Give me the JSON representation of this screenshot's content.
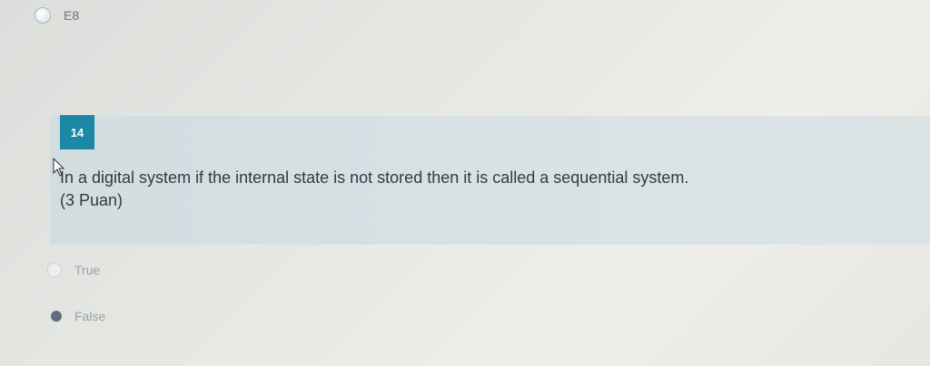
{
  "previous_option": {
    "label": "E8"
  },
  "question": {
    "number": "14",
    "text": "In a digital system if the internal state is not stored then it is called a sequential system.",
    "points": "(3 Puan)"
  },
  "answers": [
    {
      "label": "True",
      "selected": false
    },
    {
      "label": "False",
      "selected": true
    }
  ],
  "colors": {
    "question_badge": "#1b88a6",
    "panel_bg": "#d8e2e5"
  }
}
